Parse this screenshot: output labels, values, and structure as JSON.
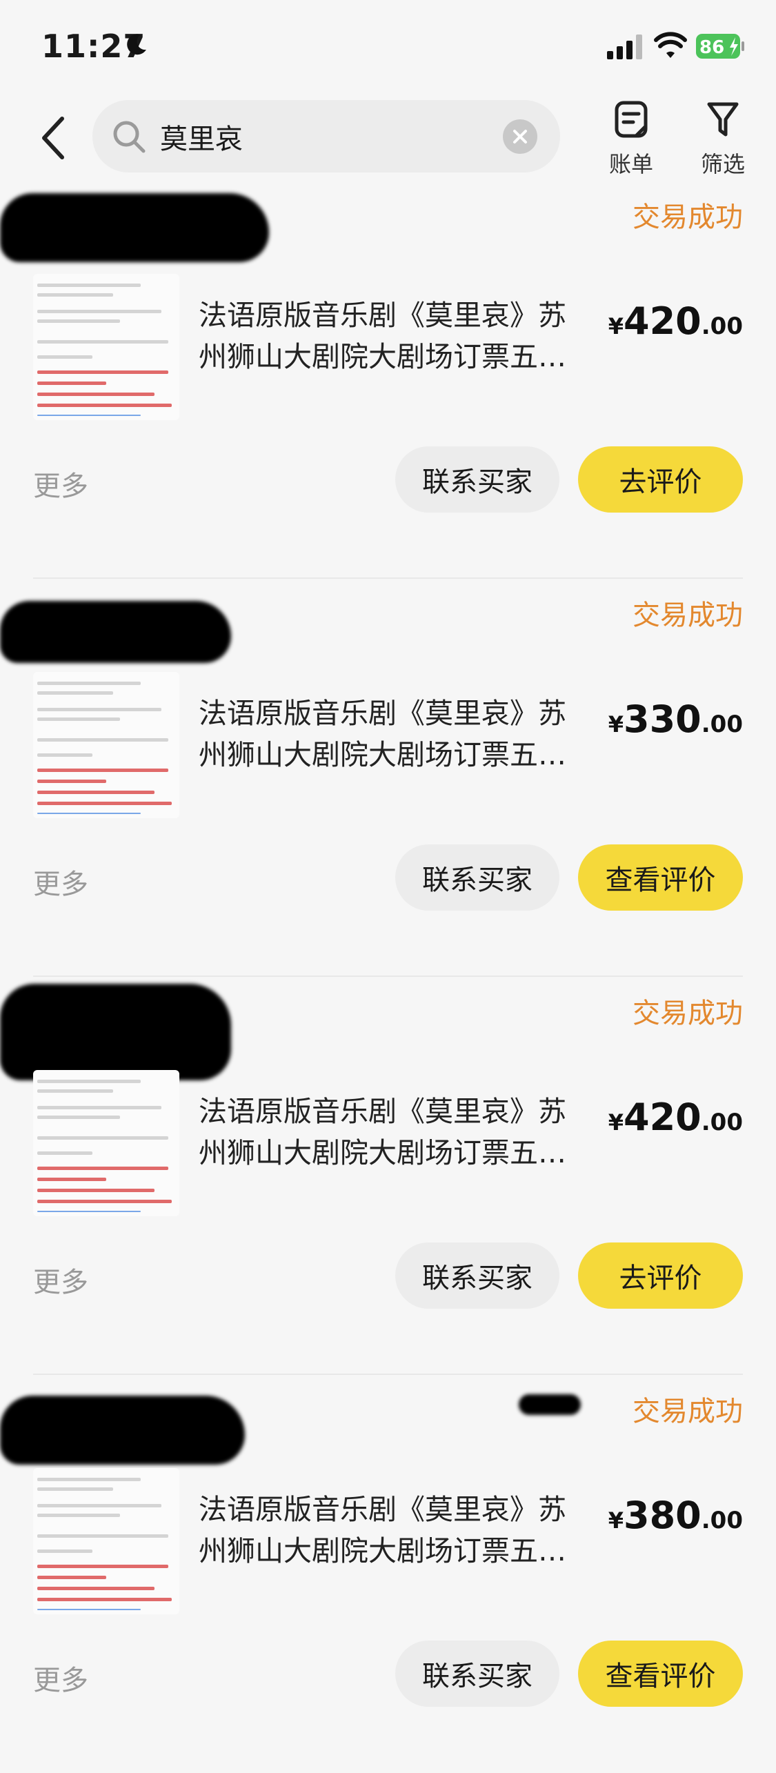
{
  "status_bar": {
    "time": "11:27",
    "battery": "86"
  },
  "search": {
    "query": "莫里哀"
  },
  "nav": {
    "bill_label": "账单",
    "filter_label": "筛选"
  },
  "orders": [
    {
      "status": "交易成功",
      "title": "法语原版音乐剧《莫里哀》苏州狮山大剧院大剧场订票五…",
      "price_int": "420",
      "price_dec": ".00",
      "currency": "¥",
      "more": "更多",
      "contact": "联系买家",
      "review": "去评价"
    },
    {
      "status": "交易成功",
      "title": "法语原版音乐剧《莫里哀》苏州狮山大剧院大剧场订票五…",
      "price_int": "330",
      "price_dec": ".00",
      "currency": "¥",
      "more": "更多",
      "contact": "联系买家",
      "review": "查看评价"
    },
    {
      "status": "交易成功",
      "title": "法语原版音乐剧《莫里哀》苏州狮山大剧院大剧场订票五…",
      "price_int": "420",
      "price_dec": ".00",
      "currency": "¥",
      "more": "更多",
      "contact": "联系买家",
      "review": "去评价"
    },
    {
      "status": "交易成功",
      "title": "法语原版音乐剧《莫里哀》苏州狮山大剧院大剧场订票五…",
      "price_int": "380",
      "price_dec": ".00",
      "currency": "¥",
      "more": "更多",
      "contact": "联系买家",
      "review": "查看评价"
    }
  ],
  "colors": {
    "status": "#e3882e",
    "primary_button": "#f5d93a",
    "secondary_button": "#ececec"
  }
}
